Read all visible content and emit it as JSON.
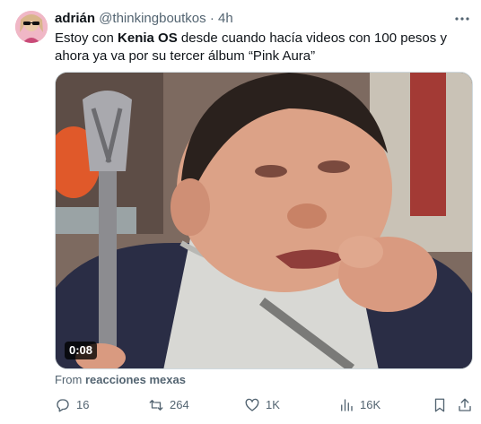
{
  "tweet": {
    "display_name": "adrián",
    "handle": "@thinkingboutkos",
    "separator": "·",
    "time": "4h",
    "text_before": "Estoy con ",
    "text_bold": "Kenia OS",
    "text_after": " desde cuando hacía videos con 100 pesos y ahora ya va por su tercer álbum “Pink Aura”",
    "video_duration": "0:08",
    "source_prefix": "From ",
    "source_name": "reacciones mexas"
  },
  "actions": {
    "replies": "16",
    "reposts": "264",
    "likes": "1K",
    "views": "16K"
  },
  "icons": [
    "more-icon",
    "reply-icon",
    "repost-icon",
    "like-icon",
    "views-icon",
    "bookmark-icon",
    "share-icon"
  ],
  "colors": {
    "text": "#0f1419",
    "muted": "#536471",
    "border": "#cfd9de"
  }
}
